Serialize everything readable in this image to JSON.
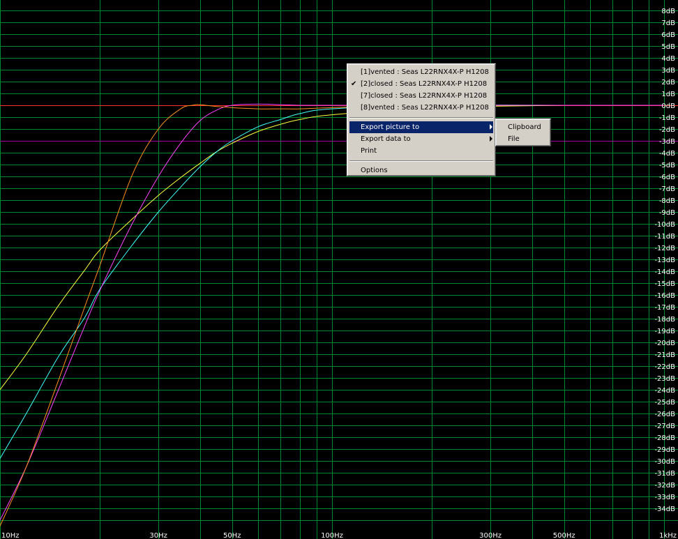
{
  "chart_data": {
    "type": "line",
    "x_scale": "log",
    "xlim": [
      10,
      1000
    ],
    "ylim": [
      -35,
      9
    ],
    "x_ticks": [
      {
        "v": 10,
        "label": "10Hz"
      },
      {
        "v": 30,
        "label": "30Hz"
      },
      {
        "v": 50,
        "label": "50Hz"
      },
      {
        "v": 100,
        "label": "100Hz"
      },
      {
        "v": 300,
        "label": "300Hz"
      },
      {
        "v": 500,
        "label": "500Hz"
      },
      {
        "v": 1000,
        "label": "1kHz"
      }
    ],
    "y_ticks": [
      8,
      7,
      6,
      5,
      4,
      3,
      2,
      1,
      0,
      -1,
      -2,
      -3,
      -4,
      -5,
      -6,
      -7,
      -8,
      -9,
      -10,
      -11,
      -12,
      -13,
      -14,
      -15,
      -16,
      -17,
      -18,
      -19,
      -20,
      -21,
      -22,
      -23,
      -24,
      -25,
      -26,
      -27,
      -28,
      -29,
      -30,
      -31,
      -32,
      -33,
      -34
    ],
    "y_unit": "dB",
    "grid": true,
    "grid_color": "#008a2e",
    "reference_lines": [
      {
        "y": 0,
        "color": "#ff3030"
      },
      {
        "y": -3,
        "color": "#a000a0"
      }
    ],
    "series": [
      {
        "color": "#ffff40",
        "x": [
          10,
          12,
          15,
          18,
          20,
          25,
          30,
          35,
          40,
          45,
          50,
          60,
          70,
          80,
          100,
          200,
          500
        ],
        "y": [
          -24,
          -21,
          -16.9,
          -13.9,
          -12.2,
          -9.6,
          -7.6,
          -6.1,
          -4.9,
          -3.9,
          -3.2,
          -2.2,
          -1.6,
          -1.2,
          -0.8,
          -0.2,
          0
        ]
      },
      {
        "color": "#40ffff",
        "x": [
          10,
          12,
          15,
          18,
          20,
          25,
          30,
          35,
          40,
          45,
          50,
          60,
          70,
          80,
          100,
          200,
          500
        ],
        "y": [
          -29.8,
          -26,
          -21.2,
          -17.9,
          -15.5,
          -11.8,
          -9,
          -6.9,
          -5.2,
          -3.9,
          -3,
          -1.8,
          -1.2,
          -0.7,
          -0.3,
          0,
          0
        ]
      },
      {
        "color": "#ff40ff",
        "x": [
          10,
          12,
          15,
          18,
          20,
          25,
          30,
          35,
          40,
          45,
          50,
          60,
          70,
          80,
          100,
          200,
          500,
          1000
        ],
        "y": [
          -35,
          -30.5,
          -24,
          -18.6,
          -15.6,
          -10,
          -6,
          -3.2,
          -1.3,
          -0.4,
          0,
          0.1,
          0.05,
          0,
          0,
          0,
          0,
          0
        ]
      },
      {
        "color": "#ff9020",
        "x": [
          10,
          12,
          15,
          18,
          20,
          25,
          30,
          35,
          38,
          40,
          45,
          50,
          60,
          70,
          80,
          100,
          150,
          200,
          300
        ],
        "y": [
          -35.5,
          -30.5,
          -23.2,
          -17,
          -13.5,
          -5.9,
          -2,
          -0.3,
          0,
          0.05,
          -0.1,
          -0.2,
          -0.3,
          -0.3,
          -0.3,
          -0.2,
          -0.05,
          0,
          0
        ]
      }
    ]
  },
  "context_menu": {
    "items": [
      {
        "label": "[1]vented : Seas L22RNX4X-P H1208",
        "checked": false
      },
      {
        "label": "[2]closed : Seas L22RNX4X-P H1208",
        "checked": true
      },
      {
        "label": "[7]closed : Seas L22RNX4X-P H1208",
        "checked": false
      },
      {
        "label": "[8]vented : Seas L22RNX4X-P H1208",
        "checked": false
      }
    ],
    "check_mark": "✔",
    "export_picture": "Export picture to",
    "export_data": "Export data to",
    "print": "Print",
    "options": "Options",
    "selected_color": "#0a246a",
    "submenu": {
      "clipboard": "Clipboard",
      "file": "File"
    }
  }
}
